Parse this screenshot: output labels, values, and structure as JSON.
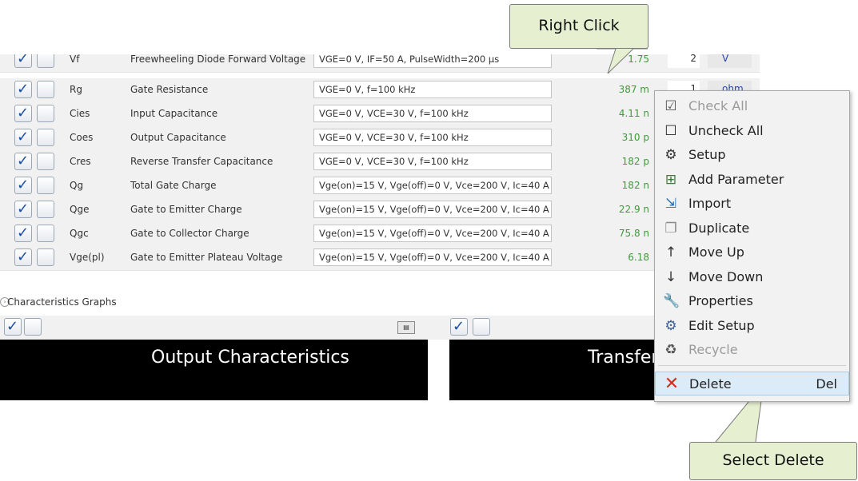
{
  "annotations": {
    "right_click": "Right Click",
    "select_delete": "Select Delete"
  },
  "rows": [
    {
      "sym": "Vf",
      "name": "Freewheeling Diode Forward Voltage",
      "cond": "VGE=0 V, IF=50 A, PulseWidth=200 µs",
      "value": "1.75",
      "digits": "2",
      "unit": "V"
    },
    {
      "sym": "Rg",
      "name": "Gate Resistance",
      "cond": "VGE=0 V, f=100 kHz",
      "value": "387 m",
      "digits": "1",
      "unit": "ohm"
    },
    {
      "sym": "Cies",
      "name": "Input Capacitance",
      "cond": "VGE=0 V, VCE=30 V, f=100 kHz",
      "value": "4.11 n"
    },
    {
      "sym": "Coes",
      "name": "Output Capacitance",
      "cond": "VGE=0 V, VCE=30 V, f=100 kHz",
      "value": "310 p"
    },
    {
      "sym": "Cres",
      "name": "Reverse Transfer Capacitance",
      "cond": "VGE=0 V, VCE=30 V, f=100 kHz",
      "value": "182 p"
    },
    {
      "sym": "Qg",
      "name": "Total Gate Charge",
      "cond": "Vge(on)=15 V, Vge(off)=0 V, Vce=200 V, Ic=40 A",
      "value": "182 n"
    },
    {
      "sym": "Qge",
      "name": "Gate to Emitter Charge",
      "cond": "Vge(on)=15 V, Vge(off)=0 V, Vce=200 V, Ic=40 A",
      "value": "22.9 n"
    },
    {
      "sym": "Qgc",
      "name": "Gate to Collector Charge",
      "cond": "Vge(on)=15 V, Vge(off)=0 V, Vce=200 V, Ic=40 A",
      "value": "75.8 n"
    },
    {
      "sym": "Vge(pl)",
      "name": "Gate to Emitter Plateau Voltage",
      "cond": "Vge(on)=15 V, Vge(off)=0 V, Vce=200 V, Ic=40 A",
      "value": "6.18"
    }
  ],
  "graphs": {
    "section_label": "Characteristics Graphs",
    "output_title": "Output Characteristics",
    "transfer_title": "Transfer"
  },
  "menu": {
    "items": [
      {
        "label": "Check All",
        "icon": "check-all-icon",
        "enabled": false
      },
      {
        "label": "Uncheck All",
        "icon": "uncheck-all-icon",
        "enabled": true
      },
      {
        "label": "Setup",
        "icon": "gear-icon",
        "enabled": true
      },
      {
        "label": "Add Parameter",
        "icon": "add-parameter-icon",
        "enabled": true
      },
      {
        "label": "Import",
        "icon": "import-icon",
        "enabled": true
      },
      {
        "label": "Duplicate",
        "icon": "duplicate-icon",
        "enabled": true
      },
      {
        "label": "Move Up",
        "icon": "arrow-up-icon",
        "enabled": true
      },
      {
        "label": "Move Down",
        "icon": "arrow-down-icon",
        "enabled": true
      },
      {
        "label": "Properties",
        "icon": "wrench-icon",
        "enabled": true
      },
      {
        "label": "Edit Setup",
        "icon": "edit-setup-icon",
        "enabled": true
      },
      {
        "label": "Recycle",
        "icon": "recycle-icon",
        "enabled": false
      }
    ],
    "delete": {
      "label": "Delete",
      "shortcut": "Del",
      "icon": "delete-x-icon",
      "selected": true
    }
  },
  "colors": {
    "value_green": "#3e9a3a",
    "unit_blue": "#2a43a5",
    "check_blue": "#1a4fa0",
    "callout_bg": "#e6efd0",
    "delete_red": "#d0311f"
  }
}
